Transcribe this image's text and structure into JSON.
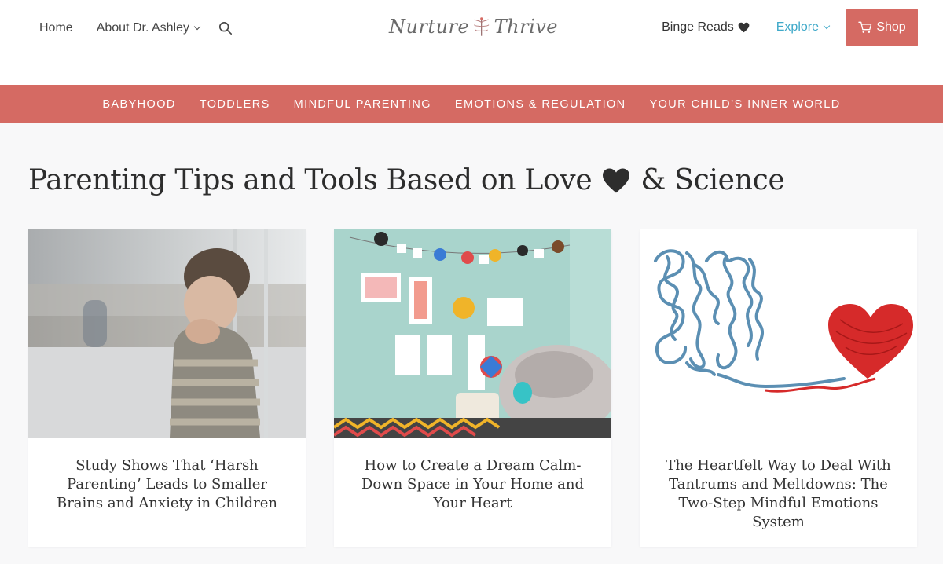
{
  "header": {
    "nav_left": [
      {
        "label": "Home"
      },
      {
        "label": "About Dr. Ashley"
      }
    ],
    "logo": {
      "word1": "Nurture",
      "word2": "Thrive"
    },
    "binge_reads": "Binge Reads",
    "explore": "Explore",
    "shop": "Shop"
  },
  "categories": [
    {
      "label": "BABYHOOD"
    },
    {
      "label": "TODDLERS"
    },
    {
      "label": "MINDFUL PARENTING"
    },
    {
      "label": "EMOTIONS & REGULATION"
    },
    {
      "label": "YOUR CHILD’S INNER WORLD"
    }
  ],
  "main": {
    "title_part1": "Parenting Tips and Tools Based on Love",
    "title_part2": "& Science",
    "cards": [
      {
        "title": "Study Shows That ‘Harsh Parenting’ Leads to Smaller Brains and Anxiety in Children"
      },
      {
        "title": "How to Create a Dream Calm-Down Space in Your Home and Your Heart"
      },
      {
        "title": "The Heartfelt Way to Deal With Tantrums and Meltdowns: The Two-Step Mindful Emotions System"
      }
    ]
  },
  "colors": {
    "accent": "#d56a63",
    "link": "#3fa9c9",
    "text": "#333333",
    "background": "#f8f8f9"
  }
}
